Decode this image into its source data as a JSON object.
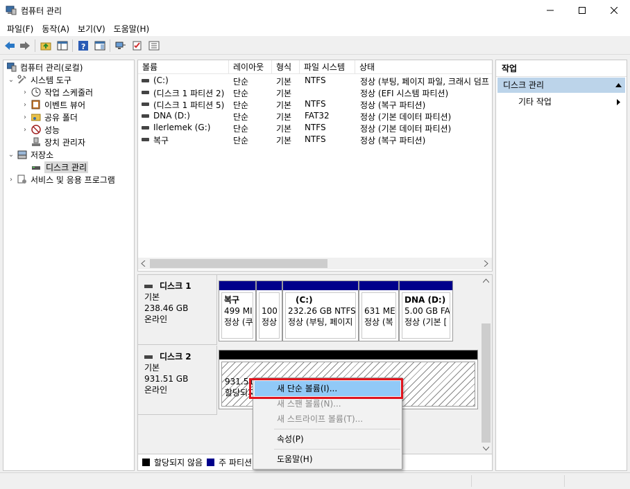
{
  "window": {
    "title": "컴퓨터 관리",
    "minimize": "—",
    "maximize": "☐",
    "close": "✕"
  },
  "menu": [
    "파일(F)",
    "동작(A)",
    "보기(V)",
    "도움말(H)"
  ],
  "tree": {
    "items": [
      {
        "label": "컴퓨터 관리(로컬)",
        "expander": ""
      },
      {
        "label": "시스템 도구",
        "expander": "⌄"
      },
      {
        "label": "작업 스케줄러",
        "expander": "›"
      },
      {
        "label": "이벤트 뷰어",
        "expander": "›"
      },
      {
        "label": "공유 폴더",
        "expander": "›"
      },
      {
        "label": "성능",
        "expander": "›"
      },
      {
        "label": "장치 관리자",
        "expander": ""
      },
      {
        "label": "저장소",
        "expander": "⌄"
      },
      {
        "label": "디스크 관리",
        "expander": ""
      },
      {
        "label": "서비스 및 응용 프로그램",
        "expander": "›"
      }
    ]
  },
  "volumes": {
    "columns": [
      "볼륨",
      "레이아웃",
      "형식",
      "파일 시스템",
      "상태"
    ],
    "rows": [
      {
        "volume": "(C:)",
        "layout": "단순",
        "type": "기본",
        "fs": "NTFS",
        "status": "정상 (부팅, 페이지 파일, 크래시 덤프"
      },
      {
        "volume": "(디스크 1 파티션 2)",
        "layout": "단순",
        "type": "기본",
        "fs": "",
        "status": "정상 (EFI 시스템 파티션)"
      },
      {
        "volume": "(디스크 1 파티션 5)",
        "layout": "단순",
        "type": "기본",
        "fs": "NTFS",
        "status": "정상 (복구 파티션)"
      },
      {
        "volume": "DNA (D:)",
        "layout": "단순",
        "type": "기본",
        "fs": "FAT32",
        "status": "정상 (기본 데이터 파티션)"
      },
      {
        "volume": "Ilerlemek (G:)",
        "layout": "단순",
        "type": "기본",
        "fs": "NTFS",
        "status": "정상 (기본 데이터 파티션)"
      },
      {
        "volume": "복구",
        "layout": "단순",
        "type": "기본",
        "fs": "NTFS",
        "status": "정상 (복구 파티션)"
      }
    ]
  },
  "disks": [
    {
      "name": "디스크 1",
      "type": "기본",
      "size": "238.46 GB",
      "state": "온라인",
      "partitions": [
        {
          "name": "복구",
          "size": "499 MI",
          "status": "정상 (쿠"
        },
        {
          "name": "",
          "size": "100",
          "status": "정상"
        },
        {
          "name": "(C:)",
          "size": "232.26 GB NTFS",
          "status": "정상 (부팅, 페이지"
        },
        {
          "name": "",
          "size": "631 ME",
          "status": "정상 (복"
        },
        {
          "name": "DNA  (D:)",
          "size": "5.00 GB FAT",
          "status": "정상 (기본 ["
        }
      ]
    },
    {
      "name": "디스크 2",
      "type": "기본",
      "size": "931.51 GB",
      "state": "온라인",
      "partitions": [
        {
          "size": "931.51 GB",
          "status": "할당되지"
        }
      ]
    }
  ],
  "legend": [
    {
      "label": "할당되지 않음",
      "color": "#000000"
    },
    {
      "label": "주 파티션",
      "color": "#00008b"
    }
  ],
  "actions": {
    "title": "작업",
    "section": "디스크 관리",
    "more": "기타 작업"
  },
  "context_menu": {
    "items": [
      {
        "label": "새 단순 볼륨(I)...",
        "enabled": true,
        "highlighted": true
      },
      {
        "label": "새 스팬 볼륨(N)...",
        "enabled": false
      },
      {
        "label": "새 스트라이프 볼륨(T)...",
        "enabled": false
      },
      {
        "label": "속성(P)",
        "enabled": true
      },
      {
        "label": "도움말(H)",
        "enabled": true
      }
    ]
  },
  "colors": {
    "primary_partition": "#00008b",
    "unallocated": "#000000",
    "selection": "#91c9f7",
    "annotation": "#e0141e"
  }
}
